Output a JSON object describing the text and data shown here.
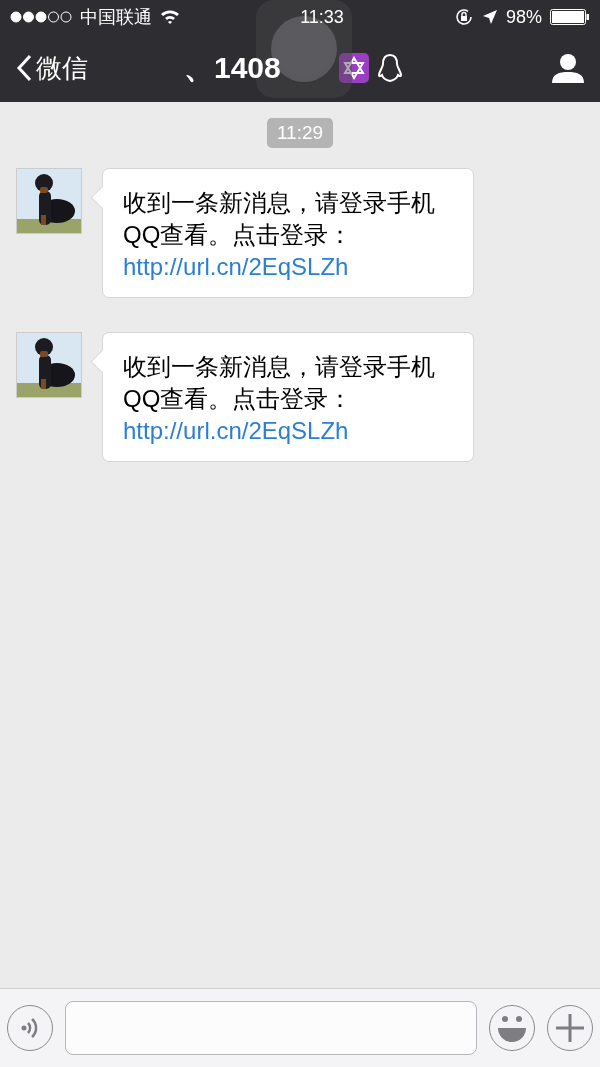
{
  "status_bar": {
    "carrier": "中国联通",
    "time": "11:33",
    "battery": "98%"
  },
  "nav": {
    "back": "微信",
    "title": "、1408"
  },
  "timestamp": "11:29",
  "messages": [
    {
      "text": "收到一条新消息，请登录手机QQ查看。点击登录：",
      "link": "http://url.cn/2EqSLZh"
    },
    {
      "text": "收到一条新消息，请登录手机QQ查看。点击登录：",
      "link": "http://url.cn/2EqSLZh"
    }
  ]
}
